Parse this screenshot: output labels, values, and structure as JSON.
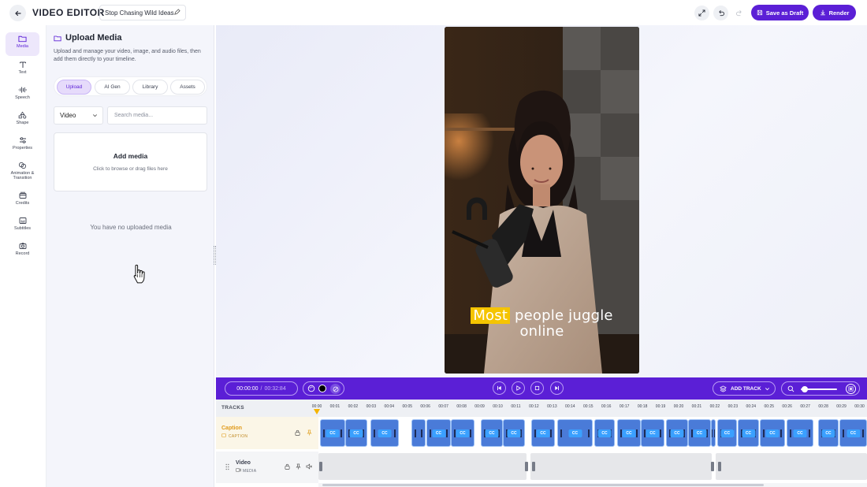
{
  "header": {
    "app_title": "VIDEO EDITOR",
    "project_name": "Stop Chasing Wild Ideas",
    "save_draft_label": "Save as Draft",
    "render_label": "Render"
  },
  "sidebar": {
    "items": [
      {
        "label": "Media",
        "icon": "folder-icon",
        "active": true
      },
      {
        "label": "Text",
        "icon": "text-icon"
      },
      {
        "label": "Speech",
        "icon": "waveform-icon"
      },
      {
        "label": "Shape",
        "icon": "shapes-icon"
      },
      {
        "label": "Properties",
        "icon": "sliders-icon"
      },
      {
        "label": "Animation & Transition",
        "icon": "animation-icon"
      },
      {
        "label": "Credits",
        "icon": "credits-icon"
      },
      {
        "label": "Subtitles",
        "icon": "subtitles-icon"
      },
      {
        "label": "Record",
        "icon": "camera-icon"
      }
    ]
  },
  "panel": {
    "title": "Upload Media",
    "description": "Upload and manage your video, image, and audio files, then add them directly to your timeline.",
    "tabs": [
      "Upload",
      "AI Gen",
      "Library",
      "Assets"
    ],
    "active_tab": "Upload",
    "filter_value": "Video",
    "search_placeholder": "Search media...",
    "dropzone_title": "Add media",
    "dropzone_subtitle": "Click to browse or drag files here",
    "empty_message": "You have no uploaded media"
  },
  "preview": {
    "caption_highlight": "Most",
    "caption_rest": " people juggle",
    "caption_line2": "online"
  },
  "transport": {
    "current_time": "00:00:00",
    "separator": "/",
    "total_time": "00:32:84",
    "add_track_label": "ADD TRACK",
    "zoom_level": 0.1
  },
  "timeline": {
    "tracks_label": "TRACKS",
    "ruler": [
      "00:00",
      "00:01",
      "00:02",
      "00:03",
      "00:04",
      "00:05",
      "00:06",
      "00:07",
      "00:08",
      "00:09",
      "00:10",
      "00:11",
      "00:12",
      "00:13",
      "00:14",
      "00:15",
      "00:16",
      "00:17",
      "00:18",
      "00:19",
      "00:20",
      "00:21",
      "00:22",
      "00:23",
      "00:24",
      "00:25",
      "00:26",
      "00:27",
      "00:28",
      "00:29",
      "00:30"
    ],
    "caption_track": {
      "name": "Caption",
      "type": "CAPTION",
      "clip_label": "CC"
    },
    "video_track": {
      "name": "Video",
      "type": "MEDIA"
    }
  },
  "colors": {
    "accent": "#5b1fd6",
    "caption_highlight": "#f5c400",
    "playhead": "#f5b400",
    "caption_track_name": "#e09a1a"
  }
}
